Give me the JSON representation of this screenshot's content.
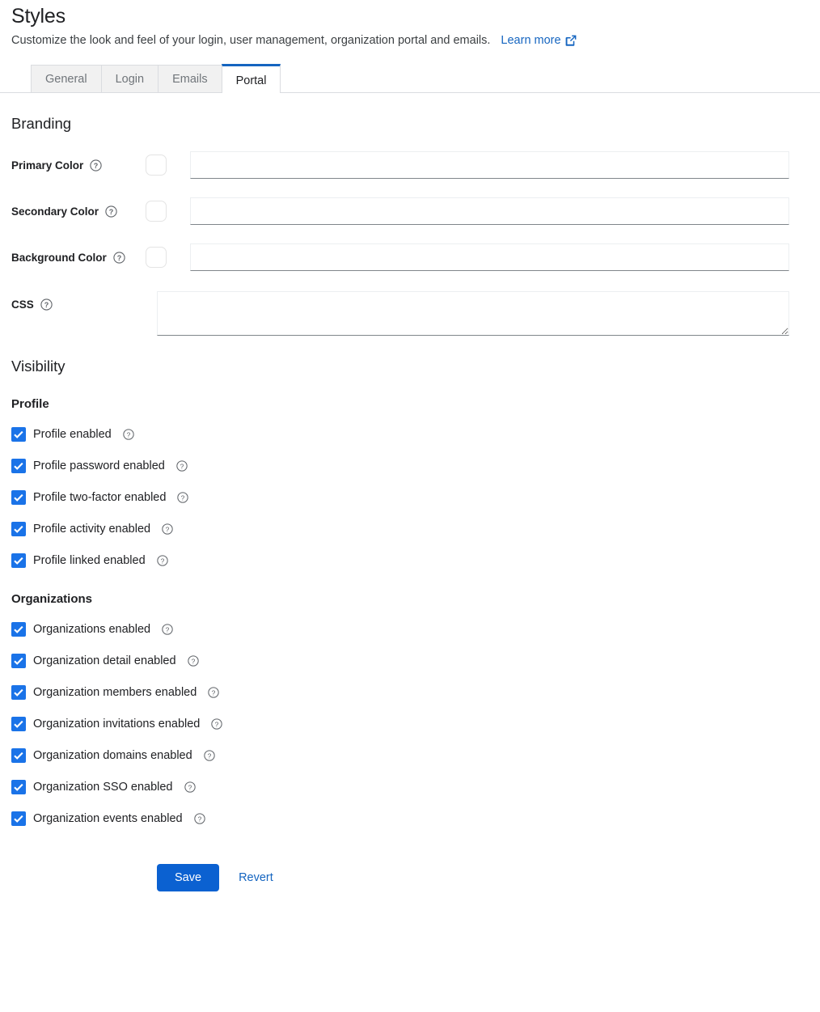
{
  "header": {
    "title": "Styles",
    "subtitle": "Customize the look and feel of your login, user management, organization portal and emails.",
    "learn_more_label": "Learn more",
    "learn_more_icon": "external-link-icon"
  },
  "tabs": [
    {
      "label": "General",
      "active": false
    },
    {
      "label": "Login",
      "active": false
    },
    {
      "label": "Emails",
      "active": false
    },
    {
      "label": "Portal",
      "active": true
    }
  ],
  "branding": {
    "section_title": "Branding",
    "fields": [
      {
        "label": "Primary Color",
        "value": "",
        "swatch": "#ffffff",
        "help": "help-icon"
      },
      {
        "label": "Secondary Color",
        "value": "",
        "swatch": "#ffffff",
        "help": "help-icon"
      },
      {
        "label": "Background Color",
        "value": "",
        "swatch": "#ffffff",
        "help": "help-icon"
      }
    ],
    "css": {
      "label": "CSS",
      "value": "",
      "help": "help-icon"
    }
  },
  "visibility": {
    "section_title": "Visibility",
    "groups": [
      {
        "title": "Profile",
        "items": [
          {
            "label": "Profile enabled",
            "checked": true
          },
          {
            "label": "Profile password enabled",
            "checked": true
          },
          {
            "label": "Profile two-factor enabled",
            "checked": true
          },
          {
            "label": "Profile activity enabled",
            "checked": true
          },
          {
            "label": "Profile linked enabled",
            "checked": true
          }
        ]
      },
      {
        "title": "Organizations",
        "items": [
          {
            "label": "Organizations enabled",
            "checked": true
          },
          {
            "label": "Organization detail enabled",
            "checked": true
          },
          {
            "label": "Organization members enabled",
            "checked": true
          },
          {
            "label": "Organization invitations enabled",
            "checked": true
          },
          {
            "label": "Organization domains enabled",
            "checked": true
          },
          {
            "label": "Organization SSO enabled",
            "checked": true
          },
          {
            "label": "Organization events enabled",
            "checked": true
          }
        ]
      }
    ]
  },
  "footer": {
    "save_label": "Save",
    "revert_label": "Revert"
  },
  "colors": {
    "accent_blue": "#1a73e8",
    "link_blue": "#1565c0",
    "button_blue": "#0b61d1",
    "tab_active_border": "#1565c0",
    "border_gray": "#dadce0"
  }
}
